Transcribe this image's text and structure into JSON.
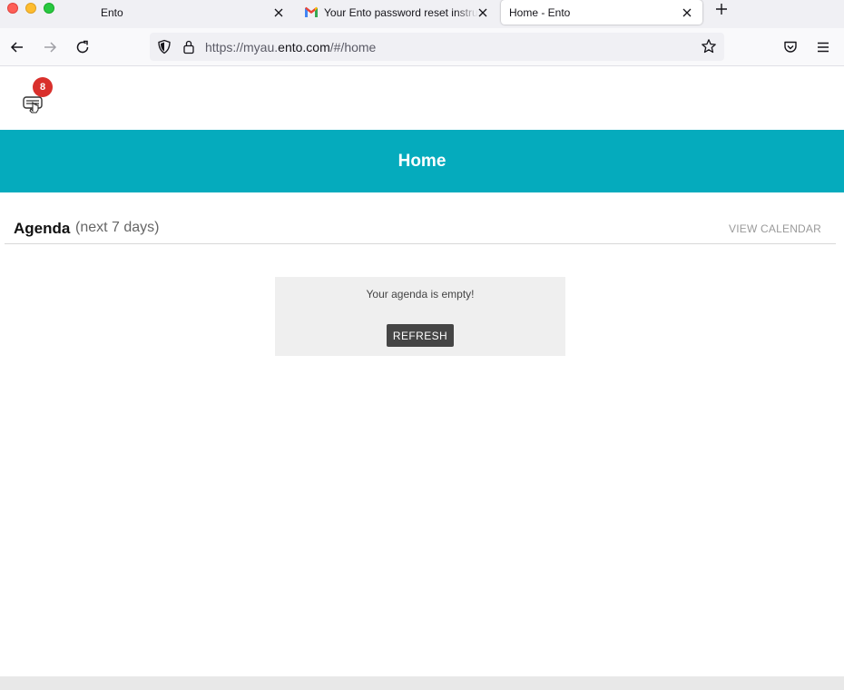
{
  "browser": {
    "tabs": [
      {
        "title": "Ento"
      },
      {
        "title": "Your Ento password reset instructions"
      },
      {
        "title": "Home - Ento"
      }
    ],
    "address": {
      "scheme": "https://myau.",
      "host": "ento.com",
      "path": "/#/home"
    }
  },
  "app": {
    "notification_count": "8",
    "header_title": "Home"
  },
  "agenda": {
    "title": "Agenda",
    "subtitle": "(next 7 days)",
    "view_calendar_label": "VIEW CALENDAR",
    "empty_message": "Your agenda is empty!",
    "refresh_label": "REFRESH"
  },
  "colors": {
    "banner": "#05abbd",
    "badge": "#d9302c",
    "button": "#454545"
  }
}
